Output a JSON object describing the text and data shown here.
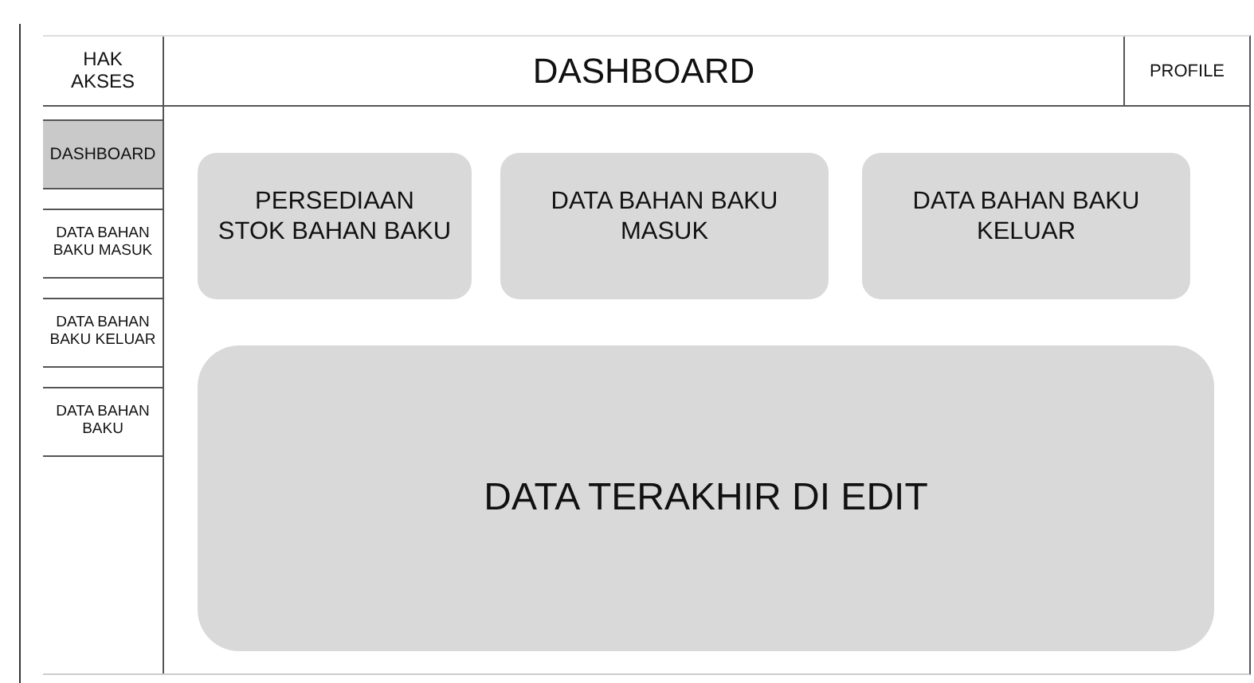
{
  "access_label": "HAK AKSES",
  "title": "DASHBOARD",
  "profile": "PROFILE",
  "sidebar": {
    "items": [
      {
        "label": "DASHBOARD",
        "selected": true
      },
      {
        "label": "DATA BAHAN BAKU MASUK",
        "selected": false
      },
      {
        "label": "DATA BAHAN BAKU KELUAR",
        "selected": false
      },
      {
        "label": "DATA BAHAN BAKU",
        "selected": false
      }
    ]
  },
  "cards": [
    {
      "label": "PERSEDIAAN\nSTOK BAHAN BAKU"
    },
    {
      "label": "DATA BAHAN BAKU\nMASUK"
    },
    {
      "label": "DATA BAHAN BAKU\nKELUAR"
    }
  ],
  "panel": {
    "label": "DATA TERAKHIR DI EDIT"
  }
}
